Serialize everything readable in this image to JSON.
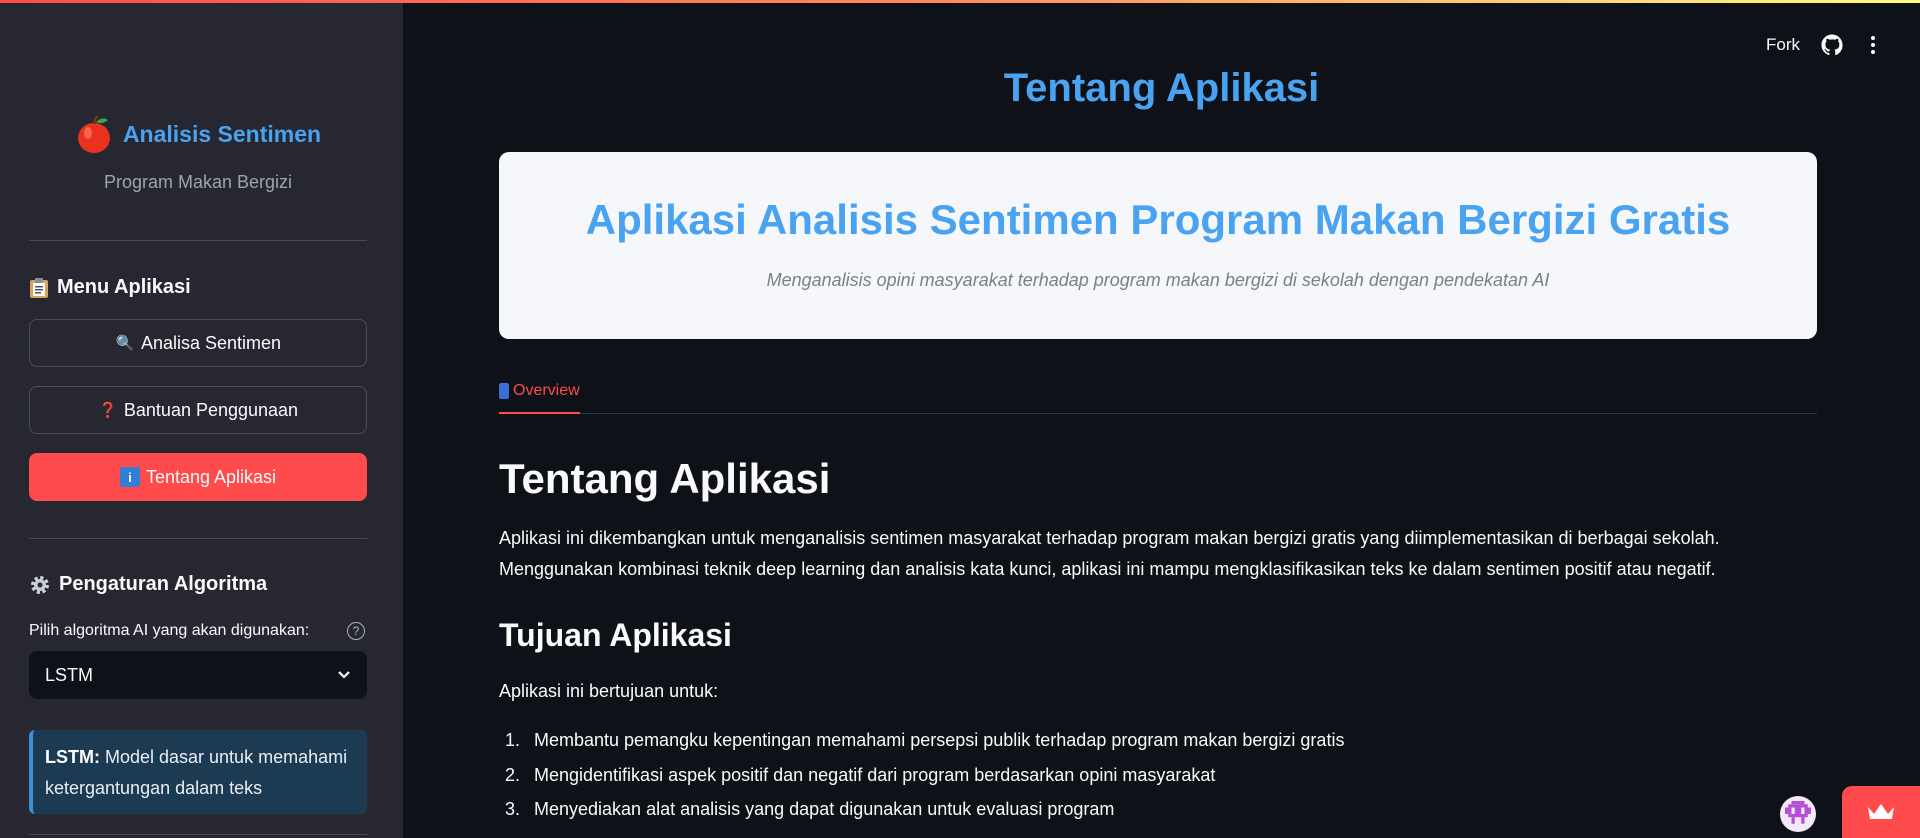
{
  "header": {
    "fork_label": "Fork",
    "github_icon": "github-icon",
    "menu_icon": "kebab-menu-icon"
  },
  "sidebar": {
    "brand_title": "Analisis Sentimen",
    "brand_subtitle": "Program Makan Bergizi",
    "brand_icon": "apple-icon",
    "menu_heading": "Menu Aplikasi",
    "menu_heading_icon": "clipboard-icon",
    "menu_items": [
      {
        "label": "Analisa Sentimen",
        "icon": "🔍",
        "active": false
      },
      {
        "label": "Bantuan Penggunaan",
        "icon": "❓",
        "active": false
      },
      {
        "label": "Tentang Aplikasi",
        "icon": "ℹ️",
        "active": true
      }
    ],
    "settings_heading": "Pengaturan Algoritma",
    "settings_heading_icon": "gear-icon",
    "select_label": "Pilih algoritma AI yang akan digunakan:",
    "select_value": "LSTM",
    "info_bold": "LSTM:",
    "info_text": " Model dasar untuk memahami ketergantungan dalam teks"
  },
  "main": {
    "page_title": "Tentang Aplikasi",
    "hero_title": "Aplikasi Analisis Sentimen Program Makan Bergizi Gratis",
    "hero_subtitle": "Menganalisis opini masyarakat terhadap program makan bergizi di sekolah dengan pendekatan AI",
    "tab_label": "Overview",
    "heading1": "Tentang Aplikasi",
    "paragraph1_line1": "Aplikasi ini dikembangkan untuk menganalisis sentimen masyarakat terhadap program makan bergizi gratis yang diimplementasikan di berbagai sekolah.",
    "paragraph1_line2": "Menggunakan kombinasi teknik deep learning dan analisis kata kunci, aplikasi ini mampu mengklasifikasikan teks ke dalam sentimen positif atau negatif.",
    "heading2": "Tujuan Aplikasi",
    "paragraph2": "Aplikasi ini bertujuan untuk:",
    "goals": [
      {
        "num": "1.",
        "text": "Membantu pemangku kepentingan memahami persepsi publik terhadap program makan bergizi gratis"
      },
      {
        "num": "2.",
        "text": "Mengidentifikasi aspek positif dan negatif dari program berdasarkan opini masyarakat"
      },
      {
        "num": "3.",
        "text": "Menyediakan alat analisis yang dapat digunakan untuk evaluasi program"
      }
    ]
  },
  "colors": {
    "accent": "#ff4b4b",
    "title_blue": "#4aa3f0",
    "sidebar_bg": "#262730",
    "main_bg": "#0e1117"
  }
}
